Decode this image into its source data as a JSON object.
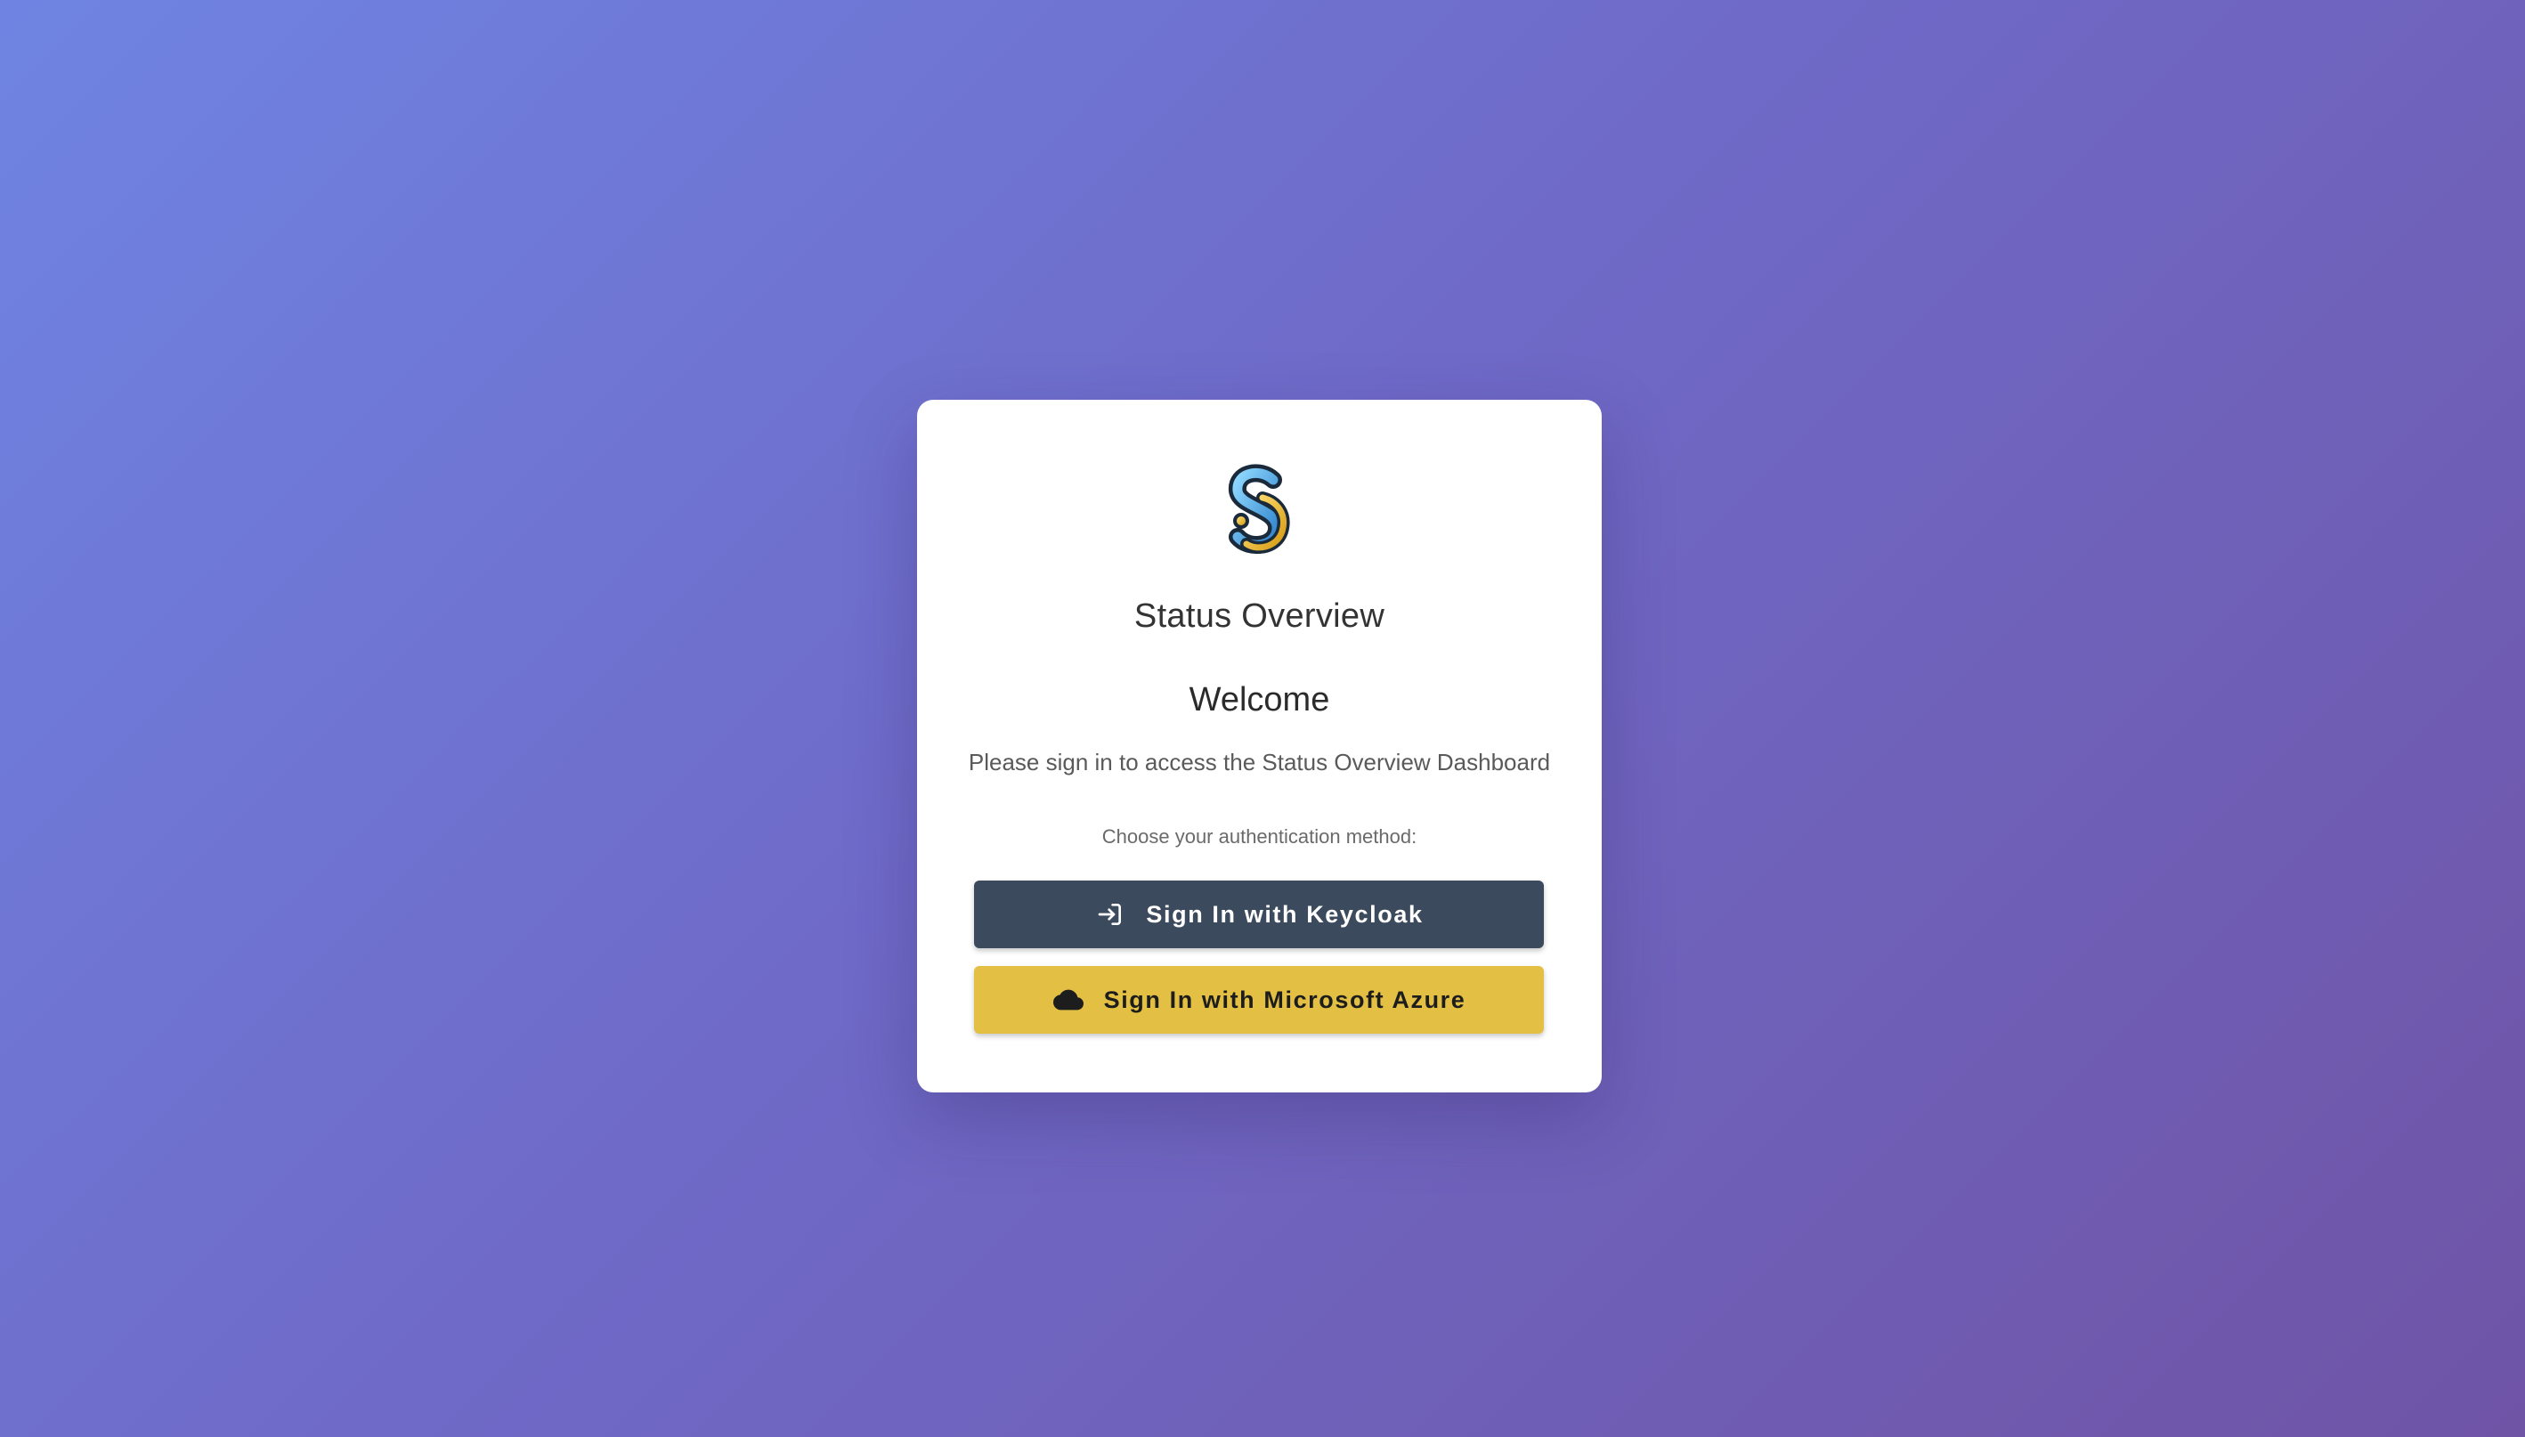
{
  "app": {
    "title": "Status Overview"
  },
  "login": {
    "welcome": "Welcome",
    "subtitle": "Please sign in to access the Status Overview Dashboard",
    "method_label": "Choose your authentication method:",
    "buttons": [
      {
        "label": "Sign In with Keycloak",
        "icon": "login-icon",
        "color": "#3c4a5d"
      },
      {
        "label": "Sign In with Microsoft Azure",
        "icon": "cloud-icon",
        "color": "#e3c043"
      }
    ]
  },
  "colors": {
    "background_start": "#6f84e2",
    "background_end": "#6f54a6",
    "card": "#ffffff"
  }
}
